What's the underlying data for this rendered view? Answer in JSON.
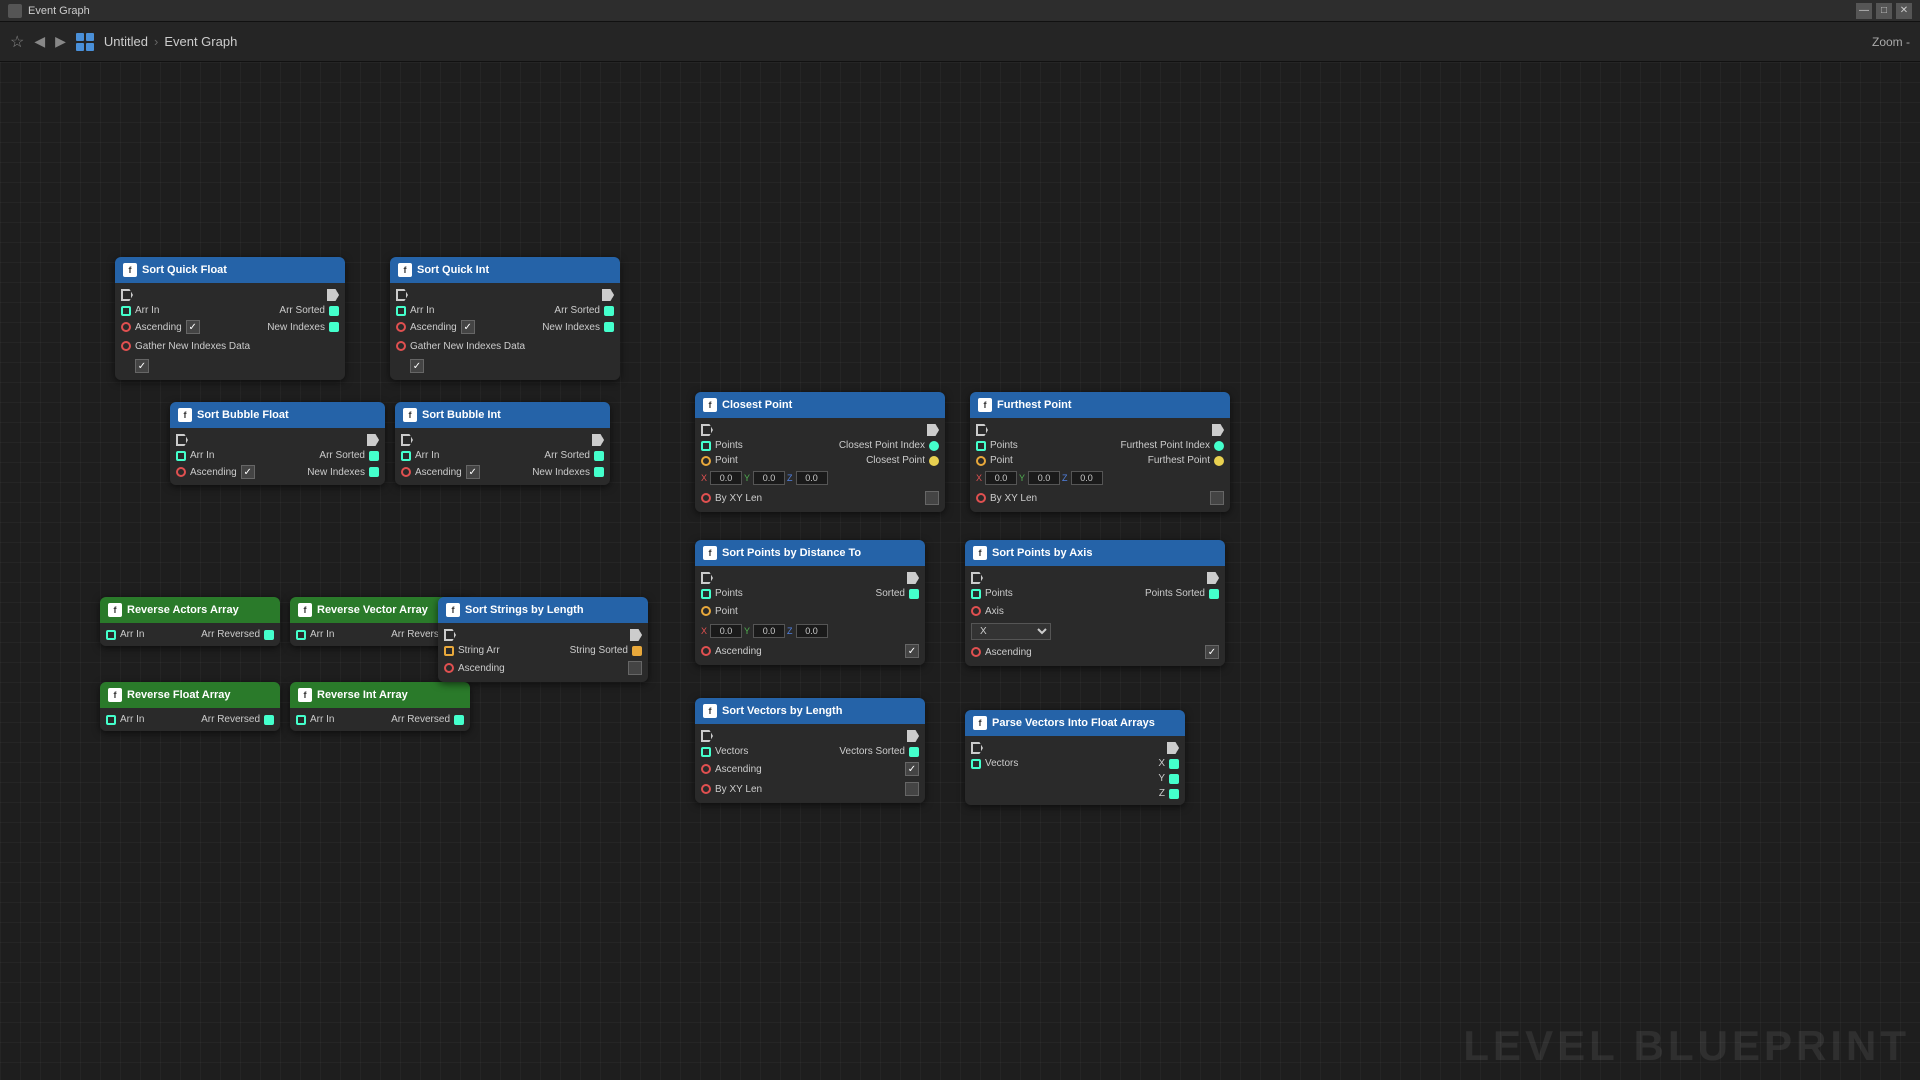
{
  "titlebar": {
    "icon": "⬛",
    "title": "Event Graph",
    "close": "✕",
    "minimize": "—",
    "maximize": "□"
  },
  "navbar": {
    "untitled": "Untitled",
    "separator": ">",
    "eventGraph": "Event Graph",
    "zoom": "Zoom -"
  },
  "nodes": {
    "sortQuickFloat": {
      "title": "Sort Quick Float",
      "arrIn": "Arr In",
      "arrSorted": "Arr Sorted",
      "ascending": "Ascending",
      "newIndexes": "New Indexes",
      "gatherNewIndexesData": "Gather New Indexes Data"
    },
    "sortQuickInt": {
      "title": "Sort Quick Int",
      "arrIn": "Arr In",
      "arrSorted": "Arr Sorted",
      "ascending": "Ascending",
      "newIndexes": "New Indexes",
      "gatherNewIndexesData": "Gather New Indexes Data"
    },
    "sortBubbleFloat": {
      "title": "Sort Bubble Float",
      "arrIn": "Arr In",
      "arrSorted": "Arr Sorted",
      "ascending": "Ascending",
      "newIndexes": "New Indexes"
    },
    "sortBubbleInt": {
      "title": "Sort Bubble Int",
      "arrIn": "Arr In",
      "arrSorted": "Arr Sorted",
      "ascending": "Ascending",
      "newIndexes": "New Indexes"
    },
    "reverseActorsArray": {
      "title": "Reverse Actors Array",
      "arrIn": "Arr In",
      "arrReversed": "Arr Reversed"
    },
    "reverseVectorArray": {
      "title": "Reverse Vector Array",
      "arrIn": "Arr In",
      "arrReversed": "Arr Reversed"
    },
    "reverseFloatArray": {
      "title": "Reverse Float Array",
      "arrIn": "Arr In",
      "arrReversed": "Arr Reversed"
    },
    "reverseIntArray": {
      "title": "Reverse Int Array",
      "arrIn": "Arr In",
      "arrReversed": "Arr Reversed"
    },
    "sortStringsByLength": {
      "title": "Sort Strings by Length",
      "stringArr": "String Arr",
      "stringSorted": "String Sorted",
      "ascending": "Ascending"
    },
    "closestPoint": {
      "title": "Closest Point",
      "points": "Points",
      "closestPointIndex": "Closest Point Index",
      "point": "Point",
      "closestPoint": "Closest Point",
      "byXYLen": "By XY Len",
      "x": "X",
      "y": "Y",
      "z": "Z",
      "xVal": "0.0",
      "yVal": "0.0",
      "zVal": "0.0"
    },
    "furthestPoint": {
      "title": "Furthest Point",
      "points": "Points",
      "furthestPointIndex": "Furthest Point Index",
      "point": "Point",
      "furthestPoint": "Furthest Point",
      "byXYLen": "By XY Len",
      "xVal": "0.0",
      "yVal": "0.0",
      "zVal": "0.0"
    },
    "sortPointsByDistanceTo": {
      "title": "Sort Points by Distance To",
      "points": "Points",
      "sorted": "Sorted",
      "point": "Point",
      "ascending": "Ascending",
      "xVal": "0.0",
      "yVal": "0.0",
      "zVal": "0.0"
    },
    "sortPointsByAxis": {
      "title": "Sort Points by Axis",
      "points": "Points",
      "pointsSorted": "Points Sorted",
      "axis": "Axis",
      "axisValue": "X",
      "ascending": "Ascending"
    },
    "sortVectorsByLength": {
      "title": "Sort Vectors by Length",
      "vectors": "Vectors",
      "vectorsSorted": "Vectors Sorted",
      "ascending": "Ascending",
      "byXYLen": "By XY Len"
    },
    "parseVectorsIntoFloatArrays": {
      "title": "Parse Vectors Into Float Arrays",
      "vectors": "Vectors",
      "x": "X",
      "y": "Y",
      "z": "Z"
    }
  },
  "watermark": "LEVEL BLUEPRINT"
}
